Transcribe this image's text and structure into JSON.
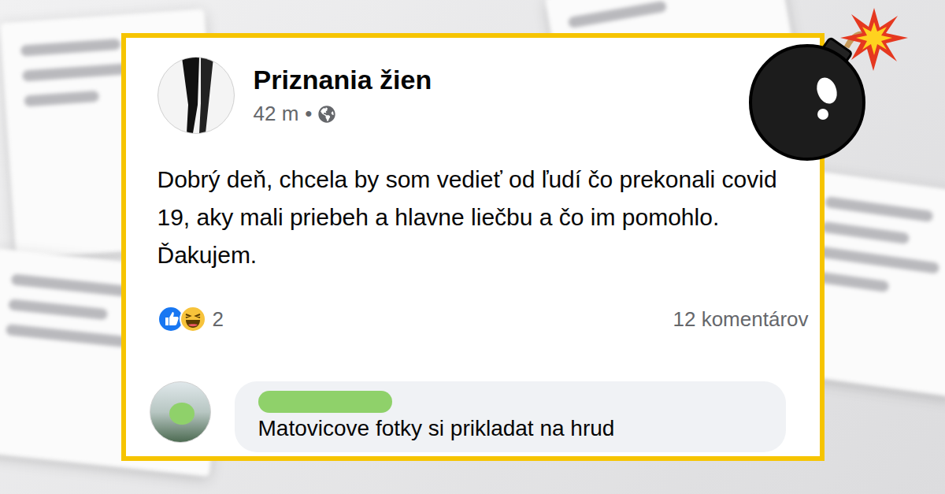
{
  "post": {
    "page_name": "Priznania žien",
    "time": "42 m",
    "separator": "•",
    "text": "Dobrý deň, chcela by som vedieť od ľudí čo prekonali covid 19, aky mali priebeh a hlavne liečbu a čo im pomohlo. Ďakujem.",
    "reaction_count": "2",
    "comment_count": "12 komentárov"
  },
  "comment": {
    "text": "Matovicove fotky si prikladat na hrud"
  }
}
